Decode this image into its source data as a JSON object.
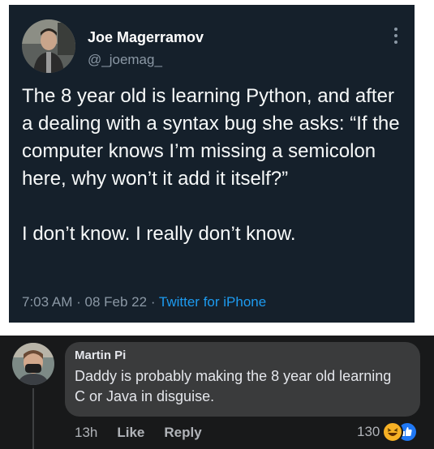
{
  "tweet": {
    "author_name": "Joe Magerramov",
    "author_handle": "@_joemag_",
    "paragraphs": [
      "The 8 year old is learning Python, and after a dealing with a syntax bug she asks: “If the computer knows I’m missing a semicolon here, why won’t it add it itself?”",
      "I don’t know. I really don’t know."
    ],
    "time": "7:03 AM",
    "date": "08 Feb 22",
    "separator": "·",
    "source": "Twitter for iPhone"
  },
  "comment": {
    "author": "Martin Pi",
    "text": "Daddy is probably making the 8 year old learning C or Java in disguise.",
    "time_ago": "13h",
    "like_label": "Like",
    "reply_label": "Reply",
    "reaction_count": "130",
    "reaction_icons": [
      "haha-icon",
      "like-icon"
    ]
  },
  "colors": {
    "tweet_bg": "#15202b",
    "tweet_link": "#1d9bf0",
    "fb_bg": "#18191a",
    "fb_bubble": "#3a3b3c"
  }
}
